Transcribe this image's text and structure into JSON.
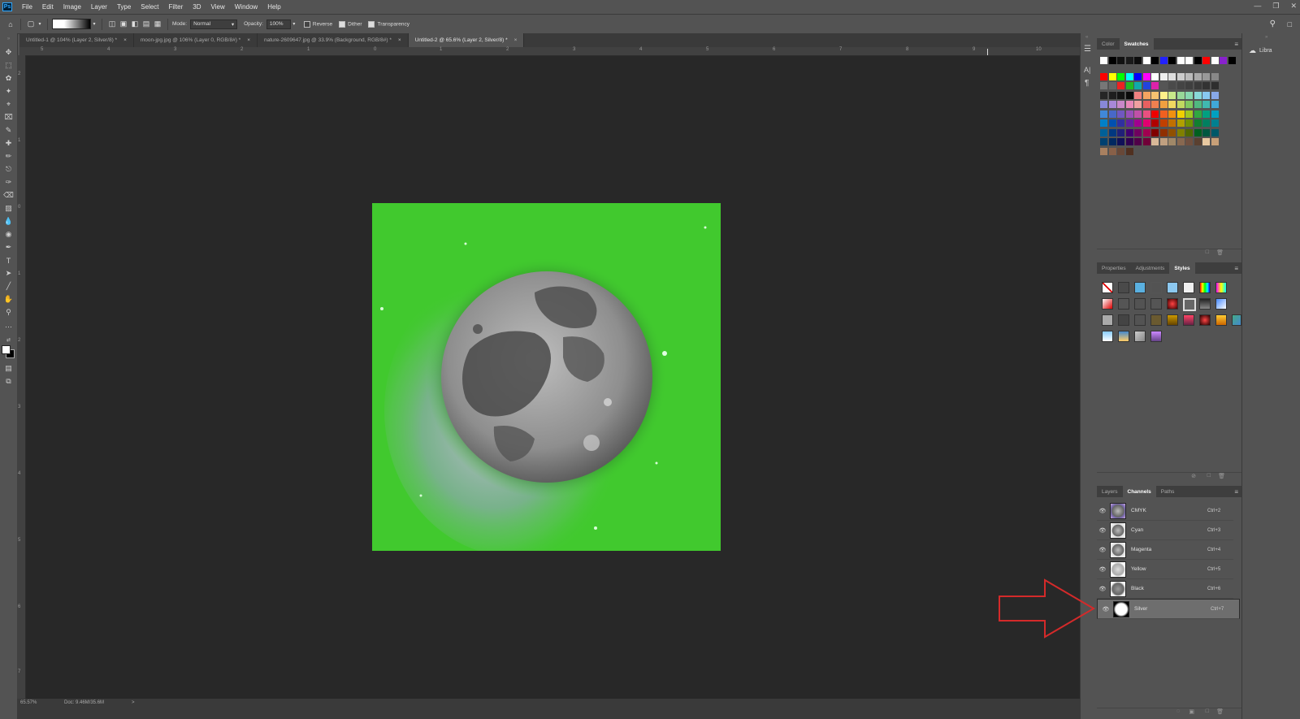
{
  "app": {
    "logo": "Ps",
    "menu": [
      "File",
      "Edit",
      "Image",
      "Layer",
      "Type",
      "Select",
      "Filter",
      "3D",
      "View",
      "Window",
      "Help"
    ]
  },
  "options": {
    "mode_label": "Mode:",
    "mode_value": "Normal",
    "opacity_label": "Opacity:",
    "opacity_value": "100%",
    "reverse_label": "Reverse",
    "dither_label": "Dither",
    "transparency_label": "Transparency"
  },
  "tabs": [
    {
      "label": "Untitled-1 @ 104% (Layer 2, Silver/8) *",
      "close": "×"
    },
    {
      "label": "moon-jpg.jpg @ 106% (Layer 0, RGB/8#) *",
      "close": "×"
    },
    {
      "label": "nature-2609647.jpg @ 33.9% (Background, RGB/8#) *",
      "close": "×"
    },
    {
      "label": "Untitled-2 @ 65.6% (Layer 2, Silver/8) *",
      "close": "×"
    }
  ],
  "ruler": {
    "top": [
      "5",
      "4",
      "3",
      "2",
      "1",
      "0",
      "1",
      "2",
      "3",
      "4",
      "5",
      "6",
      "7",
      "8",
      "9",
      "10"
    ],
    "left": [
      "2",
      "1",
      "0",
      "1",
      "2",
      "3",
      "4",
      "5",
      "6",
      "7"
    ]
  },
  "status": {
    "zoom": "65.57%",
    "doc": "Doc: 9.46M/35.6M",
    "arrow": ">"
  },
  "panels": {
    "top_tabs": [
      "Color",
      "Swatches"
    ],
    "mid_tabs": [
      "Properties",
      "Adjustments",
      "Styles"
    ],
    "bottom_tabs": [
      "Layers",
      "Channels",
      "Paths"
    ],
    "libraries": "Libra"
  },
  "swatch_rows": [
    [
      "#ffffff",
      "#000000",
      "#111111",
      "#1a1a1a",
      "#0d0d0d",
      "#ffffff",
      "#000000",
      "#2222ff",
      "#000000",
      "#ffffff",
      "#ffffff",
      "#000000",
      "#ff0000",
      "#ffffff",
      "#8822cc",
      "#000000"
    ],
    [
      "#ff0000",
      "#ffff00",
      "#00ff00",
      "#00ffff",
      "#0000ff",
      "#ff00ff",
      "#ffffff",
      "#eeeeee",
      "#dddddd",
      "#cccccc",
      "#bbbbbb",
      "#aaaaaa",
      "#999999",
      "#888888"
    ],
    [
      "#777777",
      "#666666",
      "#ee2222",
      "#22bb22",
      "#11aaaa",
      "#2244dd",
      "#dd22aa",
      "#555555",
      "#4a4a4a",
      "#444444",
      "#3f3f3f",
      "#3a3a3a",
      "#333333",
      "#2e2e2e"
    ],
    [
      "#262626",
      "#1e1e1e",
      "#141414",
      "#0a0a0a",
      "#f08080",
      "#f4a460",
      "#f6c270",
      "#fff08a",
      "#c8e88a",
      "#98d898",
      "#88d8b0",
      "#88d8d8",
      "#88c8f0",
      "#88a8e8"
    ],
    [
      "#8888d8",
      "#a888d8",
      "#c888c8",
      "#e888b8",
      "#f0a0a0",
      "#e86060",
      "#f08050",
      "#f0a040",
      "#f0d860",
      "#c0d860",
      "#80c860",
      "#50b880",
      "#40b8b0",
      "#40a8d8"
    ],
    [
      "#4088d8",
      "#4868c8",
      "#7058c0",
      "#9850b8",
      "#c050a8",
      "#e85080",
      "#ee0000",
      "#f06020",
      "#f09010",
      "#f0d000",
      "#a0c820",
      "#30a840",
      "#00a080",
      "#00a0c0"
    ],
    [
      "#0080c8",
      "#0050b0",
      "#3030a0",
      "#6020a0",
      "#a00090",
      "#e00070",
      "#b00000",
      "#c04000",
      "#c07000",
      "#b0a000",
      "#709000",
      "#108030",
      "#008060",
      "#008090"
    ],
    [
      "#006098",
      "#003880",
      "#202078",
      "#400070",
      "#700060",
      "#a00050",
      "#800000",
      "#903000",
      "#905000",
      "#808000",
      "#506800",
      "#006020",
      "#005840",
      "#005868"
    ],
    [
      "#004070",
      "#002860",
      "#101058",
      "#300050",
      "#500048",
      "#700038",
      "#d8b898",
      "#c0a080",
      "#a08868",
      "#886850",
      "#705040",
      "#5a4030",
      "#e8c8a0",
      "#c8a078"
    ],
    [
      "#a88060",
      "#886048",
      "#684838",
      "#503020"
    ]
  ],
  "channels": [
    {
      "name": "CMYK",
      "shortcut": "Ctrl+2"
    },
    {
      "name": "Cyan",
      "shortcut": "Ctrl+3"
    },
    {
      "name": "Magenta",
      "shortcut": "Ctrl+4"
    },
    {
      "name": "Yellow",
      "shortcut": "Ctrl+5"
    },
    {
      "name": "Black",
      "shortcut": "Ctrl+6"
    },
    {
      "name": "Silver",
      "shortcut": "Ctrl+7"
    }
  ],
  "colors": {
    "document_background": "#41c92e",
    "workspace": "#282828",
    "panel": "#535353",
    "arrow": "#d42a2a"
  }
}
